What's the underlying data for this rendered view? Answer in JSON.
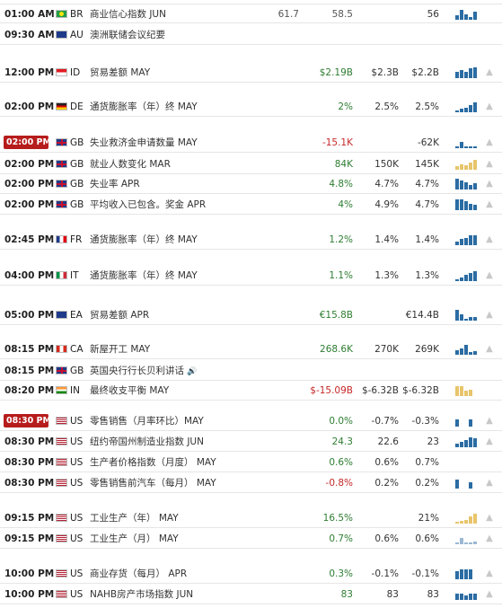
{
  "events": [
    {
      "time": "01:00 AM",
      "flag": "BR",
      "country": "BR",
      "event": "商业信心指数 JUN",
      "actual": "58.5",
      "forecast": "",
      "previous": "56",
      "extra": "61.7",
      "color": "neu",
      "bars": [
        0.4,
        0.95,
        0.5,
        0.25,
        0.75
      ],
      "bar_style": "dark",
      "bell": false,
      "highlight": false
    },
    {
      "time": "09:30 AM",
      "flag": "AU",
      "country": "AU",
      "event": "澳洲联储会议纪要",
      "actual": "",
      "forecast": "",
      "previous": "",
      "color": "neu",
      "bars": [],
      "bell": false,
      "highlight": false
    },
    {
      "time": "12:00 PM",
      "flag": "ID",
      "country": "ID",
      "event": "贸易差额 MAY",
      "actual": "$2.19B",
      "forecast": "$2.3B",
      "previous": "$2.2B",
      "color": "pos",
      "bars": [
        0.6,
        0.75,
        0.55,
        0.95,
        1.0
      ],
      "bar_style": "dark",
      "bell": true,
      "highlight": false
    },
    {
      "time": "02:00 PM",
      "flag": "DE",
      "country": "DE",
      "event": "通货膨胀率（年）终 MAY",
      "actual": "2%",
      "forecast": "2.5%",
      "previous": "2.5%",
      "color": "pos",
      "bars": [
        0.15,
        0.3,
        0.45,
        0.65,
        0.95
      ],
      "bar_style": "dark",
      "bell": true,
      "highlight": false
    },
    {
      "time": "02:00 PM",
      "flag": "GB",
      "country": "GB",
      "event": "失业救济金申请数量 MAY",
      "actual": "-15.1K",
      "forecast": "",
      "previous": "-62K",
      "color": "neg",
      "bars": [
        0.2,
        0.6,
        0.2,
        0.15,
        0.15
      ],
      "bar_style": "dark",
      "bell": true,
      "highlight": true
    },
    {
      "time": "02:00 PM",
      "flag": "GB",
      "country": "GB",
      "event": "就业人数变化 MAR",
      "actual": "84K",
      "forecast": "150K",
      "previous": "145K",
      "color": "pos",
      "bars": [
        0.3,
        0.5,
        0.45,
        0.7,
        0.95
      ],
      "bar_style": "gold",
      "bell": true,
      "highlight": false
    },
    {
      "time": "02:00 PM",
      "flag": "GB",
      "country": "GB",
      "event": "失业率 APR",
      "actual": "4.8%",
      "forecast": "4.7%",
      "previous": "4.7%",
      "color": "pos",
      "bars": [
        1.0,
        0.85,
        0.7,
        0.45,
        0.55
      ],
      "bar_style": "dark",
      "bell": true,
      "highlight": false
    },
    {
      "time": "02:00 PM",
      "flag": "GB",
      "country": "GB",
      "event": "平均收入已包含。奖金 APR",
      "actual": "4%",
      "forecast": "4.9%",
      "previous": "4.7%",
      "color": "pos",
      "bars": [
        1.0,
        1.0,
        0.85,
        0.6,
        0.5
      ],
      "bar_style": "dark",
      "bell": true,
      "highlight": false
    },
    {
      "time": "02:45 PM",
      "flag": "FR",
      "country": "FR",
      "event": "通货膨胀率（年）终 MAY",
      "actual": "1.2%",
      "forecast": "1.4%",
      "previous": "1.4%",
      "color": "pos",
      "bars": [
        0.3,
        0.55,
        0.7,
        0.9,
        0.95
      ],
      "bar_style": "dark",
      "bell": true,
      "highlight": false
    },
    {
      "time": "04:00 PM",
      "flag": "IT",
      "country": "IT",
      "event": "通货膨胀率（年）终 MAY",
      "actual": "1.1%",
      "forecast": "1.3%",
      "previous": "1.3%",
      "color": "pos",
      "bars": [
        0.2,
        0.35,
        0.55,
        0.75,
        0.95
      ],
      "bar_style": "dark",
      "bell": true,
      "highlight": false
    },
    {
      "time": "05:00 PM",
      "flag": "EA",
      "country": "EA",
      "event": "贸易差额 APR",
      "actual": "€15.8B",
      "forecast": "",
      "previous": "€14.4B",
      "color": "pos",
      "bars": [
        1.0,
        0.55,
        0.2,
        0.35,
        0.35
      ],
      "bar_style": "dark",
      "bell": true,
      "highlight": false
    },
    {
      "time": "08:15 PM",
      "flag": "CA",
      "country": "CA",
      "event": "新屋开工 MAY",
      "actual": "268.6K",
      "forecast": "270K",
      "previous": "269K",
      "color": "pos",
      "bars": [
        0.45,
        0.6,
        0.95,
        0.25,
        0.35
      ],
      "bar_style": "dark",
      "bell": true,
      "highlight": false
    },
    {
      "time": "08:15 PM",
      "flag": "GB",
      "country": "GB",
      "event": "英国央行行长贝利讲话",
      "speaker": "🔊",
      "actual": "",
      "forecast": "",
      "previous": "",
      "color": "neu",
      "bars": [],
      "bell": false,
      "highlight": false
    },
    {
      "time": "08:20 PM",
      "flag": "IN",
      "country": "IN",
      "event": "最终收支平衡 MAY",
      "actual": "$-15.09B",
      "forecast": "$-6.32B",
      "previous": "$-6.32B",
      "color": "neg",
      "bars": [
        0.95,
        0.95,
        0.5,
        0.6,
        0.0
      ],
      "bar_style": "gold",
      "bell": false,
      "highlight": false
    },
    {
      "time": "08:30 PM",
      "flag": "US",
      "country": "US",
      "event": "零售销售（月率环比）MAY",
      "actual": "0.0%",
      "forecast": "-0.7%",
      "previous": "-0.3%",
      "color": "pos",
      "bars": [
        0.65,
        0.0,
        0.0,
        0.7,
        0.0
      ],
      "bar_style": "dark",
      "bell": true,
      "highlight": true
    },
    {
      "time": "08:30 PM",
      "flag": "US",
      "country": "US",
      "event": "纽约帝国州制造业指数 JUN",
      "actual": "24.3",
      "forecast": "22.6",
      "previous": "23",
      "color": "pos",
      "bars": [
        0.3,
        0.5,
        0.7,
        0.95,
        0.85
      ],
      "bar_style": "dark",
      "bell": true,
      "highlight": false
    },
    {
      "time": "08:30 PM",
      "flag": "US",
      "country": "US",
      "event": "生产者价格指数（月度） MAY",
      "actual": "0.6%",
      "forecast": "0.6%",
      "previous": "0.7%",
      "color": "pos",
      "bars": [],
      "bar_style": "dark",
      "bell": false,
      "highlight": false
    },
    {
      "time": "08:30 PM",
      "flag": "US",
      "country": "US",
      "event": "零售销售前汽车（每月） MAY",
      "actual": "-0.8%",
      "forecast": "0.2%",
      "previous": "0.2%",
      "color": "neg",
      "bars": [
        0.8,
        0.0,
        0.0,
        0.6,
        0.0
      ],
      "bar_style": "dark",
      "bell": true,
      "highlight": false
    },
    {
      "time": "09:15 PM",
      "flag": "US",
      "country": "US",
      "event": "工业生产（年） MAY",
      "actual": "16.5%",
      "forecast": "",
      "previous": "21%",
      "color": "pos",
      "bars": [
        0.15,
        0.25,
        0.3,
        0.65,
        0.95
      ],
      "bar_style": "gold",
      "bell": true,
      "highlight": false
    },
    {
      "time": "09:15 PM",
      "flag": "US",
      "country": "US",
      "event": "工业生产（月） MAY",
      "actual": "0.7%",
      "forecast": "0.6%",
      "previous": "0.6%",
      "color": "pos",
      "bars": [
        0.2,
        0.6,
        0.2,
        0.2,
        0.25
      ],
      "bar_style": "lt",
      "bell": true,
      "highlight": false
    },
    {
      "time": "10:00 PM",
      "flag": "US",
      "country": "US",
      "event": "商业存货（每月） APR",
      "actual": "0.3%",
      "forecast": "-0.1%",
      "previous": "-0.1%",
      "color": "pos",
      "bars": [
        0.75,
        0.95,
        0.95,
        0.9,
        0.0
      ],
      "bar_style": "dark",
      "bell": true,
      "highlight": false
    },
    {
      "time": "10:00 PM",
      "flag": "US",
      "country": "US",
      "event": "NAHB房产市场指数 JUN",
      "actual": "83",
      "forecast": "83",
      "previous": "83",
      "color": "pos",
      "bars": [
        0.6,
        0.6,
        0.4,
        0.6,
        0.55
      ],
      "bar_style": "dark",
      "bell": true,
      "highlight": false
    }
  ],
  "flag_colors": {
    "BR": [
      "#229e45",
      "#f8e509"
    ],
    "AU": [
      "#1f3a8a",
      "#1f3a8a"
    ],
    "ID": [
      "#e31b23",
      "#ffffff"
    ],
    "DE": [
      "#222222",
      "#dd0000",
      "#ffce00"
    ],
    "GB": [
      "#1f3a8a",
      "#c8102e"
    ],
    "FR": [
      "#1f3a8a",
      "#ffffff",
      "#e1000f"
    ],
    "IT": [
      "#009246",
      "#ffffff",
      "#ce2b37"
    ],
    "EA": [
      "#1f3a8a",
      "#1f3a8a"
    ],
    "CA": [
      "#d52b1e",
      "#ffffff",
      "#d52b1e"
    ],
    "IN": [
      "#ff9933",
      "#ffffff",
      "#138808"
    ],
    "US": [
      "#b22234",
      "#ffffff"
    ]
  },
  "icons": {
    "bell": "bell-icon",
    "speaker": "speaker-icon"
  }
}
